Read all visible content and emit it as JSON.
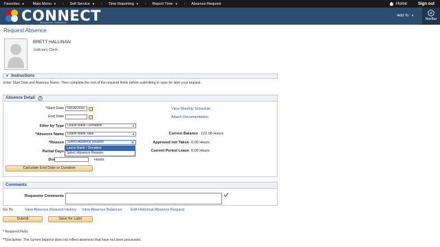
{
  "nav": {
    "favorites": "Favorites",
    "main_menu": "Main Menu",
    "breadcrumb": [
      "Self Service",
      "Time Reporting",
      "Report Time",
      "Absence Request"
    ],
    "home": "Home",
    "sign_out": "Sign out"
  },
  "header": {
    "logo": "CONNECT",
    "logo_sub": "Maryland Judiciary",
    "add_to": "Add To",
    "navbar": "NavBar"
  },
  "page": {
    "title": "Request Absence",
    "employee_name": "BRETT HALLINAN",
    "employee_title": "Judiciary Clerk"
  },
  "instructions": {
    "heading": "Instructions",
    "text": "Enter Start Date and Absence Name. Then complete the rest of the required fields before submitting or save for later your request."
  },
  "absence_detail": {
    "heading": "Absence Detail",
    "start_date_label": "*Start Date",
    "start_date_value": "03/28/2016",
    "end_date_label": "End Date",
    "end_date_value": "",
    "filter_label": "Filter by Type",
    "filter_value": "Leave Bank / Donation",
    "absence_name_label": "*Absence Name",
    "absence_name_value": "Leave Bank Take",
    "reason_label": "*Reason",
    "reason_value": "Select Absence Reason",
    "reason_options": [
      "Leave Bank / Donation",
      "Select Absence Reason"
    ],
    "partial_days_label": "Partial Days",
    "duration_label": "Duration",
    "duration_value": "",
    "duration_unit": "Hours",
    "calc_button": "Calculate End Date or Duration",
    "view_monthly_schedule": "View Monthly Schedule",
    "attach_documentation": "Attach Documentation",
    "current_balance_label": "Current Balance",
    "current_balance_value": "122.06 Hours",
    "approved_not_taken_label": "Approved not Taken",
    "approved_not_taken_value": "0.00 Hours",
    "current_period_leave_label": "Current Period Leave",
    "current_period_leave_value": "0.00 Hours"
  },
  "comments": {
    "heading": "Comments",
    "requestor_label": "Requestor Comments"
  },
  "goto": {
    "label": "Go To",
    "links": [
      "View Absence Request History",
      "View Absence Balances",
      "Edit Historical Absence Request"
    ]
  },
  "buttons": {
    "submit": "Submit",
    "save_for_later": "Save for Later"
  },
  "footnotes": {
    "required": "* Required Field",
    "disclaimer": "**Disclaimer: The current balance does not reflect absences that have not been processed."
  },
  "colors": {
    "banner": "#2b4d6f",
    "topnav": "#1a1a1a",
    "link": "#2b5a8f",
    "button": "#f0cf8c",
    "dropdown_highlight": "#2c69c9"
  }
}
